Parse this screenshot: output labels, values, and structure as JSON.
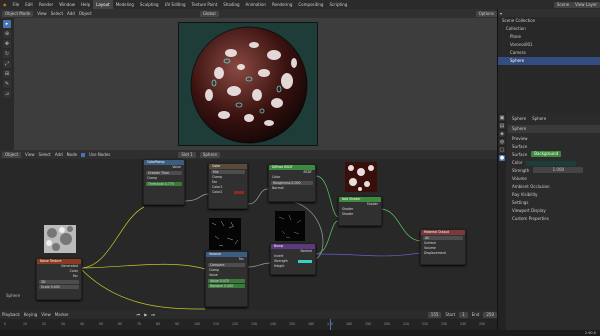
{
  "menu": [
    "File",
    "Edit",
    "Render",
    "Window",
    "Help"
  ],
  "workspaces": [
    "Layout",
    "Modeling",
    "Sculpting",
    "UV Editing",
    "Texture Paint",
    "Shading",
    "Animation",
    "Rendering",
    "Compositing",
    "Scripting"
  ],
  "active_workspace": "Layout",
  "scene": {
    "label": "Scene",
    "view_layer": "View Layer"
  },
  "viewport": {
    "mode": "Object Mode",
    "menus": [
      "View",
      "Select",
      "Add",
      "Object"
    ],
    "orientation": "Global",
    "options": "Options",
    "object_label": ""
  },
  "node_editor": {
    "mode": "Object",
    "menus": [
      "View",
      "Select",
      "Add",
      "Node"
    ],
    "use_nodes": "Use Nodes",
    "slot": "Slot 1",
    "material": "Sphere",
    "corner_label": "Sphere"
  },
  "nodes": {
    "tex_coord": {
      "title": "Texture Coordinate",
      "outputs": [
        "Generated",
        "Normal",
        "UV",
        "Object"
      ]
    },
    "noise": {
      "title": "Noise Texture",
      "rows": [
        "Generated",
        "Color",
        "Fac",
        "3D",
        "Scale 5.000"
      ]
    },
    "map_range": {
      "title": "Map Range",
      "fields": [
        "Linear",
        "Clamp",
        "Value",
        "From Min",
        "From Max",
        "To Min",
        "To Max"
      ]
    },
    "color_ramp": {
      "title": "ColorRamp",
      "value_field": "Value",
      "fields": [
        "Greater Than",
        "Clamp",
        "Threshold 0.775"
      ]
    },
    "mix": {
      "title": "Color",
      "fields": [
        "Mix",
        "Clamp",
        "Fac",
        "Color1",
        "Color2"
      ]
    },
    "diffuse": {
      "title": "Diffuse BSDF",
      "fields": [
        "BSDF",
        "Color",
        "Roughness 0.000",
        "Normal"
      ]
    },
    "voronoi": {
      "title": "Voronoi",
      "fields": [
        "Fac",
        "Compare",
        "Clamp",
        "Value",
        "Value 0.475",
        "Random 0.000"
      ]
    },
    "bump": {
      "title": "Bump",
      "fields": [
        "Normal",
        "Invert",
        "Strength",
        "Height",
        "Normal"
      ]
    },
    "add_shader": {
      "title": "Add Shader",
      "fields": [
        "Shader",
        "Shader",
        "Shader"
      ]
    },
    "material_output": {
      "title": "Material Output",
      "fields": [
        "All",
        "Surface",
        "Volume",
        "Displacement"
      ]
    }
  },
  "timeline": {
    "menus": [
      "Playback",
      "Keying",
      "View",
      "Marker"
    ],
    "frame": "155",
    "start_label": "Start",
    "start": "1",
    "end_label": "End",
    "end": "250",
    "ticks": [
      "0",
      "10",
      "20",
      "30",
      "40",
      "50",
      "60",
      "70",
      "80",
      "90",
      "100",
      "110",
      "120",
      "130",
      "140",
      "150",
      "160",
      "170",
      "180",
      "190",
      "200",
      "210",
      "220",
      "230",
      "240",
      "250"
    ]
  },
  "outliner": {
    "title": "Scene Collection",
    "items": [
      "Collection",
      "Plane",
      "Voronoi001",
      "Camera",
      "Sphere"
    ],
    "selected": 4
  },
  "properties": {
    "object_name": "Sphere",
    "material_name": "Sphere",
    "sections": [
      "Preview",
      "Surface",
      "Volume",
      "Ambient Occlusion",
      "Ray Visibility",
      "Settings",
      "Viewport Display",
      "Custom Properties"
    ],
    "surface": {
      "surface_label": "Surface",
      "surface_value": "Background",
      "color_label": "Color",
      "strength_label": "Strength",
      "strength_value": "1.000"
    }
  },
  "status": {
    "version": "2.90.0"
  },
  "colors": {
    "accent": "#4772b3",
    "world_bg": "#1e3d38",
    "header_tex": "#8a3a1f",
    "header_shader": "#3d8a3d",
    "header_input": "#7a3a3a",
    "header_conv": "#3a5d80"
  }
}
